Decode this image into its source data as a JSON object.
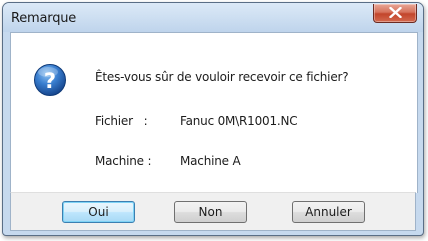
{
  "dialog": {
    "title": "Remarque",
    "close_icon": "close-icon",
    "question_icon": "question-icon",
    "message": "Êtes-vous sûr de vouloir recevoir ce fichier?",
    "file": {
      "label": "Fichier   :",
      "value": "Fanuc 0M\\R1001.NC"
    },
    "machine": {
      "label": "Machine :",
      "value": "Machine A"
    }
  },
  "buttons": {
    "yes_label": "Oui",
    "no_label": "Non",
    "cancel_label": "Annuler"
  },
  "colors": {
    "title_bar": "#cfe0f2",
    "close_button": "#c2452b",
    "question_icon": "#1f5fb0",
    "default_button_border": "#3c7fb1"
  }
}
